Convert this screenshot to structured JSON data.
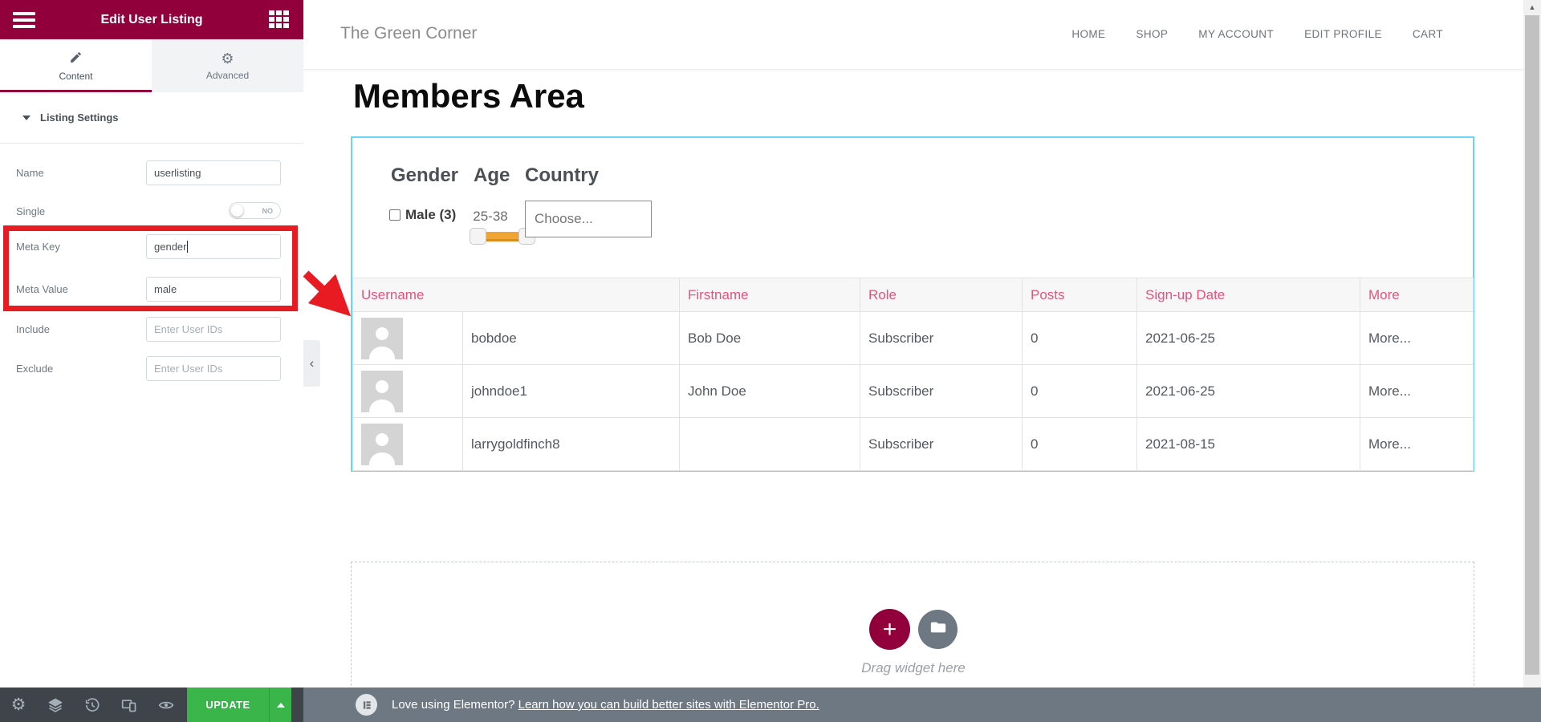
{
  "panel": {
    "title": "Edit User Listing",
    "tabs": [
      {
        "label": "Content"
      },
      {
        "label": "Advanced"
      }
    ],
    "section": "Listing Settings",
    "fields": {
      "name": {
        "label": "Name",
        "value": "userlisting"
      },
      "single": {
        "label": "Single",
        "state": "NO"
      },
      "meta_key": {
        "label": "Meta Key",
        "value": "gender"
      },
      "meta_value": {
        "label": "Meta Value",
        "value": "male"
      },
      "include": {
        "label": "Include",
        "placeholder": "Enter User IDs"
      },
      "exclude": {
        "label": "Exclude",
        "placeholder": "Enter User IDs"
      }
    },
    "update_label": "UPDATE"
  },
  "site": {
    "brand": "The Green Corner",
    "nav": [
      "HOME",
      "SHOP",
      "MY ACCOUNT",
      "EDIT PROFILE",
      "CART"
    ],
    "page_title": "Members Area"
  },
  "filters": {
    "gender_label": "Gender",
    "age_label": "Age",
    "country_label": "Country",
    "male_option": "Male (3)",
    "age_range": "25-38",
    "country_placeholder": "Choose..."
  },
  "table": {
    "headers": [
      "Username",
      "Firstname",
      "Role",
      "Posts",
      "Sign-up Date",
      "More"
    ],
    "rows": [
      {
        "username": "bobdoe",
        "firstname": "Bob Doe",
        "role": "Subscriber",
        "posts": "0",
        "signup_date": "2021-06-25",
        "more": "More..."
      },
      {
        "username": "johndoe1",
        "firstname": "John Doe",
        "role": "Subscriber",
        "posts": "0",
        "signup_date": "2021-06-25",
        "more": "More..."
      },
      {
        "username": "larrygoldfinch8",
        "firstname": "",
        "role": "Subscriber",
        "posts": "0",
        "signup_date": "2021-08-15",
        "more": "More..."
      }
    ]
  },
  "canvas": {
    "drag_hint": "Drag widget here"
  },
  "notice": {
    "prefix": "Love using Elementor? ",
    "link": "Learn how you can build better sites with Elementor Pro."
  },
  "colors": {
    "panel_accent": "#92003B",
    "update_green": "#39b54a",
    "table_accent": "#e4537b",
    "widget_outline": "#6bd5f5",
    "annotation_red": "#e81b23",
    "slider_orange": "#f0a432"
  }
}
